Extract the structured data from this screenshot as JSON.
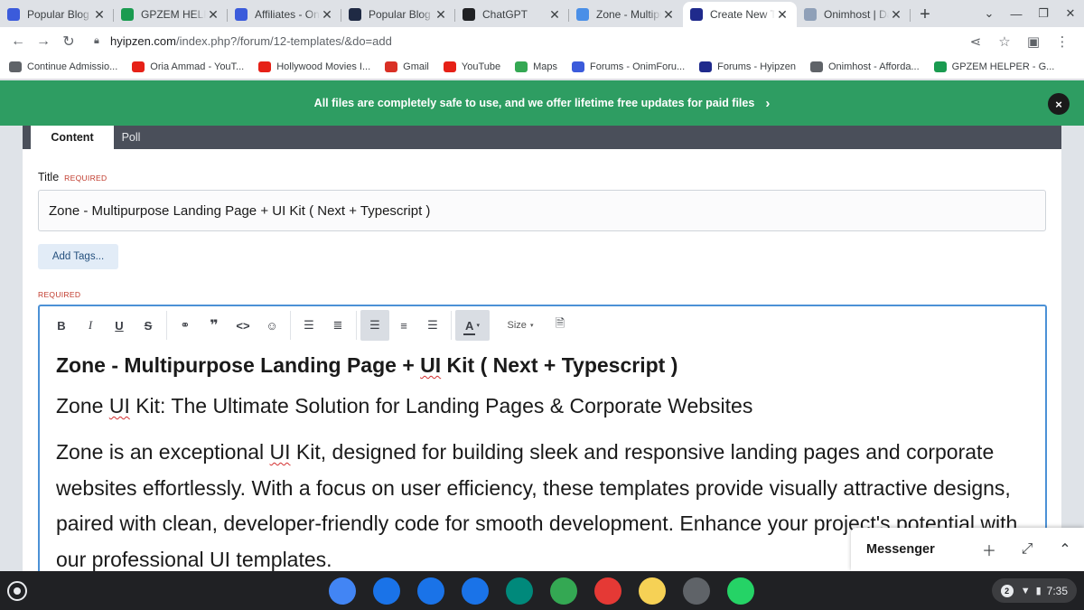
{
  "browser": {
    "tabs": [
      {
        "title": "Popular Blog A",
        "icon": "onim-icon",
        "color": "#3b5bdb"
      },
      {
        "title": "GPZEM HELPE",
        "icon": "plus-icon",
        "color": "#1a9b50"
      },
      {
        "title": "Affiliates - Onim",
        "icon": "onim-icon",
        "color": "#3b5bdb"
      },
      {
        "title": "Popular Blog A",
        "icon": "nb-icon",
        "color": "#1f2a44"
      },
      {
        "title": "ChatGPT",
        "icon": "chatgpt-icon",
        "color": "#202124"
      },
      {
        "title": "Zone - Multipu",
        "icon": "dv-icon",
        "color": "#4a8fe7"
      },
      {
        "title": "Create New To",
        "icon": "hyipzen-icon",
        "color": "#1f2a8c"
      },
      {
        "title": "Onimhost | Da",
        "icon": "mail-icon",
        "color": "#8fa0b8"
      }
    ],
    "active_tab": 6,
    "tab_close": "✕",
    "new_tab": "+",
    "url_host": "hyipzen.com",
    "url_path": "/index.php?/forum/12-templates/&do=add",
    "bookmarks": [
      {
        "label": "Continue Admissio...",
        "color": "#5f6368"
      },
      {
        "label": "Oria Ammad - YouT...",
        "color": "#e62117"
      },
      {
        "label": "Hollywood Movies I...",
        "color": "#e62117"
      },
      {
        "label": "Gmail",
        "color": "#d93025"
      },
      {
        "label": "YouTube",
        "color": "#e62117"
      },
      {
        "label": "Maps",
        "color": "#34a853"
      },
      {
        "label": "Forums - OnimForu...",
        "color": "#3b5bdb"
      },
      {
        "label": "Forums - Hyipzen",
        "color": "#1f2a8c"
      },
      {
        "label": "Onimhost - Afforda...",
        "color": "#5f6368"
      },
      {
        "label": "GPZEM HELPER - G...",
        "color": "#1a9b50"
      }
    ]
  },
  "banner": {
    "text": "All files are completely safe to use, and we offer lifetime free updates for paid files",
    "close": "×"
  },
  "form": {
    "tabs": [
      "Content",
      "Poll"
    ],
    "title_label": "Title",
    "required": "REQUIRED",
    "title_value": "Zone - Multipurpose Landing Page + UI Kit ( Next + Typescript )",
    "add_tags": "Add Tags...",
    "editor_required": "REQUIRED",
    "size_label": "Size",
    "editor": {
      "h1_a": "Zone - Multipurpose Landing Page + ",
      "h1_ui": "UI",
      "h1_b": " Kit ( Next + Typescript )",
      "h2_a": "Zone ",
      "h2_ui": "UI",
      "h2_b": " Kit: The Ultimate Solution for Landing Pages & Corporate Websites",
      "p_a": "Zone is an exceptional ",
      "p_ui": "UI",
      "p_b": " Kit, designed for building sleek and responsive landing pages and corporate websites effortlessly. With a focus on user efficiency, these templates provide visually attractive designs, paired with clean, developer-friendly code for smooth development. Enhance your project's potential with our professional UI templates."
    }
  },
  "messenger": {
    "title": "Messenger"
  },
  "shelf": {
    "apps": [
      {
        "name": "chrome",
        "color": "#4285f4"
      },
      {
        "name": "calendar",
        "color": "#1a73e8"
      },
      {
        "name": "files",
        "color": "#1a73e8"
      },
      {
        "name": "messages",
        "color": "#1a73e8"
      },
      {
        "name": "meet",
        "color": "#00897b"
      },
      {
        "name": "play-store",
        "color": "#34a853"
      },
      {
        "name": "app-red",
        "color": "#e53935"
      },
      {
        "name": "keep",
        "color": "#f6d155"
      },
      {
        "name": "settings",
        "color": "#5f6368"
      },
      {
        "name": "whatsapp",
        "color": "#25d366"
      }
    ],
    "notif_count": "2",
    "time": "7:35"
  }
}
